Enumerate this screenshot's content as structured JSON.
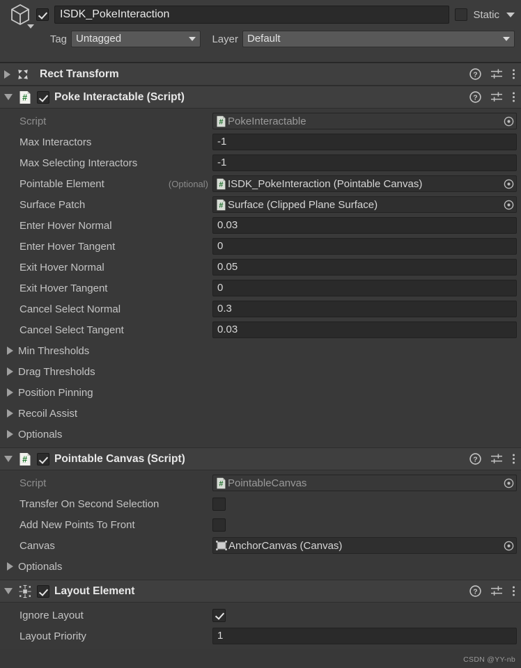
{
  "gameobject": {
    "icon": "cube-icon",
    "enabled": true,
    "name": "ISDK_PokeInteraction",
    "static_label": "Static",
    "static_checked": false,
    "tag_label": "Tag",
    "tag_value": "Untagged",
    "layer_label": "Layer",
    "layer_value": "Default"
  },
  "header_icons": {
    "help": "help-icon",
    "preset": "preset-icon",
    "menu": "more-menu-icon"
  },
  "components": [
    {
      "title": "Rect Transform",
      "icon": "rect-transform-icon",
      "expanded": false,
      "has_enable_checkbox": false,
      "rows": []
    },
    {
      "title": "Poke Interactable (Script)",
      "icon": "script-icon",
      "expanded": true,
      "has_enable_checkbox": true,
      "enabled": true,
      "rows": [
        {
          "kind": "object",
          "label": "Script",
          "readonly": true,
          "badge": "script-badge",
          "value": "PokeInteractable"
        },
        {
          "kind": "text",
          "label": "Max Interactors",
          "value": "-1"
        },
        {
          "kind": "text",
          "label": "Max Selecting Interactors",
          "value": "-1"
        },
        {
          "kind": "object",
          "label": "Pointable Element",
          "optional": "(Optional)",
          "badge": "script-badge",
          "value": "ISDK_PokeInteraction (Pointable Canvas)"
        },
        {
          "kind": "object",
          "label": "Surface Patch",
          "badge": "script-badge",
          "value": "Surface (Clipped Plane Surface)"
        },
        {
          "kind": "text",
          "label": "Enter Hover Normal",
          "value": "0.03"
        },
        {
          "kind": "text",
          "label": "Enter Hover Tangent",
          "value": "0"
        },
        {
          "kind": "text",
          "label": "Exit Hover Normal",
          "value": "0.05"
        },
        {
          "kind": "text",
          "label": "Exit Hover Tangent",
          "value": "0"
        },
        {
          "kind": "text",
          "label": "Cancel Select Normal",
          "value": "0.3"
        },
        {
          "kind": "text",
          "label": "Cancel Select Tangent",
          "value": "0.03"
        },
        {
          "kind": "foldout",
          "label": "Min Thresholds"
        },
        {
          "kind": "foldout",
          "label": "Drag Thresholds"
        },
        {
          "kind": "foldout",
          "label": "Position Pinning"
        },
        {
          "kind": "foldout",
          "label": "Recoil Assist"
        },
        {
          "kind": "foldout",
          "label": "Optionals"
        }
      ]
    },
    {
      "title": "Pointable Canvas (Script)",
      "icon": "script-icon",
      "expanded": true,
      "has_enable_checkbox": true,
      "enabled": true,
      "rows": [
        {
          "kind": "object",
          "label": "Script",
          "readonly": true,
          "badge": "script-badge",
          "value": "PointableCanvas"
        },
        {
          "kind": "checkbox",
          "label": "Transfer On Second Selection",
          "checked": false
        },
        {
          "kind": "checkbox",
          "label": "Add New Points To Front",
          "checked": false
        },
        {
          "kind": "object",
          "label": "Canvas",
          "badge": "canvas-badge",
          "value": "AnchorCanvas (Canvas)"
        },
        {
          "kind": "foldout",
          "label": "Optionals"
        }
      ]
    },
    {
      "title": "Layout Element",
      "icon": "layout-element-icon",
      "expanded": true,
      "has_enable_checkbox": true,
      "enabled": true,
      "rows": [
        {
          "kind": "checkbox",
          "label": "Ignore Layout",
          "checked": true
        },
        {
          "kind": "text",
          "label": "Layout Priority",
          "value": "1"
        }
      ]
    }
  ],
  "watermark": "CSDN @YY-nb",
  "colors": {
    "background": "#383838",
    "header": "#3c3c3c",
    "component_header": "#3f3f3f",
    "field": "#2a2a2a",
    "script_green": "#2f8a3b"
  }
}
